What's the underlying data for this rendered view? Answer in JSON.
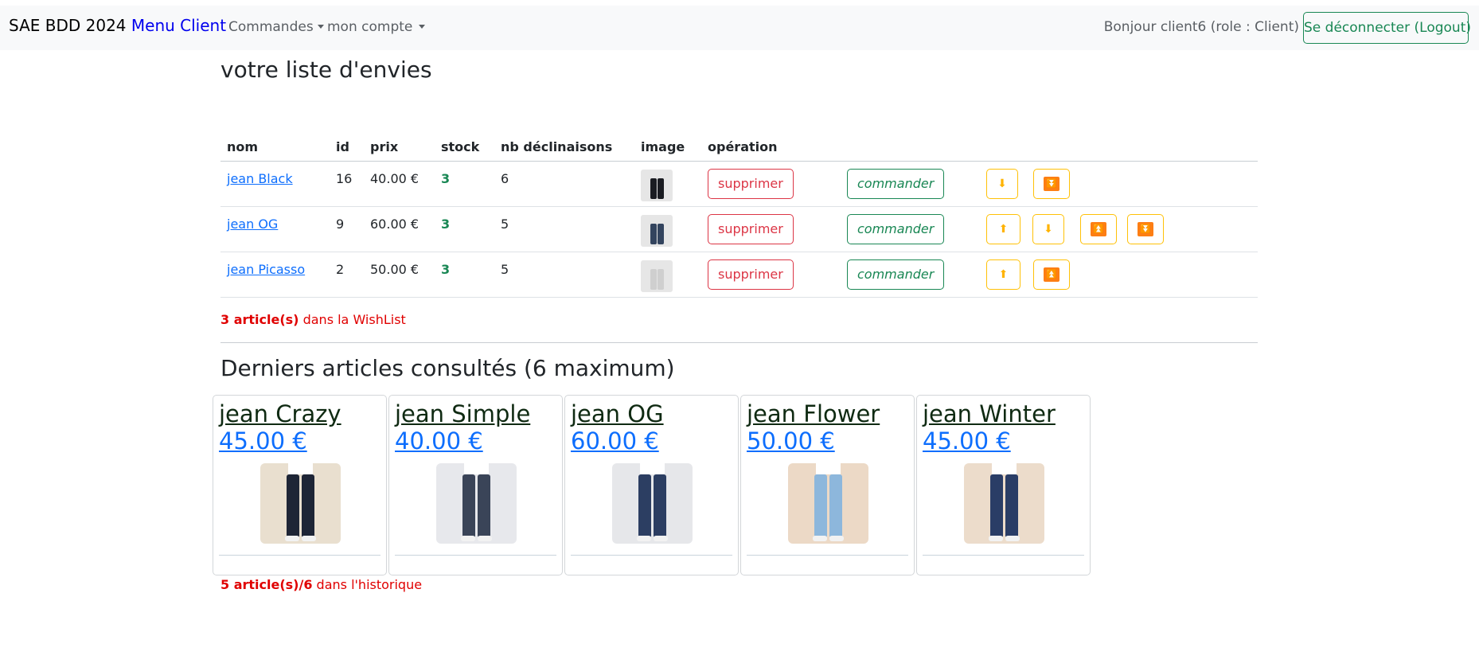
{
  "navbar": {
    "brand": "SAE BDD 2024",
    "brand_accent": "Menu Client",
    "menu_commandes": "Commandes",
    "menu_compte": "mon compte",
    "greeting": "Bonjour client6 (role : Client)",
    "logout_label": "Se déconnecter (Logout)"
  },
  "wishlist": {
    "title": "votre liste d'envies",
    "columns": [
      "nom",
      "id",
      "prix",
      "stock",
      "nb déclinaisons",
      "image",
      "opération"
    ],
    "rows": [
      {
        "name": "jean Black",
        "id": "16",
        "price": "40.00 €",
        "stock": "3",
        "variants": "6",
        "image_icon": "black-jeans-thumbnail",
        "delete_label": "supprimer",
        "order_label": "commander"
      },
      {
        "name": "jean OG",
        "id": "9",
        "price": "60.00 €",
        "stock": "3",
        "variants": "5",
        "image_icon": "navy-jeans-thumbnail",
        "delete_label": "supprimer",
        "order_label": "commander"
      },
      {
        "name": "jean Picasso",
        "id": "2",
        "price": "50.00 €",
        "stock": "3",
        "variants": "5",
        "image_icon": "light-jeans-thumbnail",
        "delete_label": "supprimer",
        "order_label": "commander"
      }
    ],
    "count_strong": "3 article(s)",
    "count_text": " dans la WishList"
  },
  "history": {
    "title": "Derniers articles consultés (6 maximum)",
    "items": [
      {
        "name": "jean Crazy",
        "price": "45.00 €",
        "image_icon": "jeans-photo-dark-navy",
        "bg": "#e9dfcf",
        "jean": "#1e2536"
      },
      {
        "name": "jean Simple",
        "price": "40.00 €",
        "image_icon": "jeans-photo-grey-blue",
        "bg": "#e7e8ec",
        "jean": "#3a4458"
      },
      {
        "name": "jean OG",
        "price": "60.00 €",
        "image_icon": "jeans-photo-navy",
        "bg": "#e6e7ea",
        "jean": "#2c3e62"
      },
      {
        "name": "jean Flower",
        "price": "50.00 €",
        "image_icon": "jeans-photo-light-blue",
        "bg": "#ecd9c6",
        "jean": "#8db7dc"
      },
      {
        "name": "jean Winter",
        "price": "45.00 €",
        "image_icon": "jeans-photo-dark-blue",
        "bg": "#ecdccb",
        "jean": "#2a3d66"
      }
    ],
    "count_strong": "5 article(s)/6",
    "count_text": " dans l'historique"
  },
  "colors": {
    "accent_blue": "#0d6efd",
    "success": "#198754",
    "danger": "#dc3545",
    "warning": "#ffc107",
    "orange": "#fd7e14",
    "count_red": "#e00000"
  }
}
